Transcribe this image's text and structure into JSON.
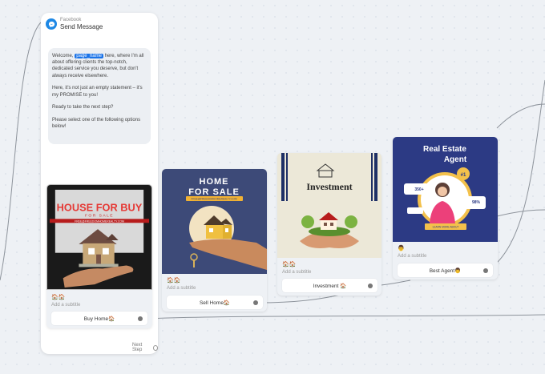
{
  "node": {
    "platform": "Facebook",
    "title": "Send Message",
    "message": {
      "p1_before": "Welcome, ",
      "p1_tag": "page_name",
      "p1_after": " here, where I'm all about offering clients the top-notch, dedicated service you deserve, but don't always receive elsewhere.",
      "p2": "Here, it's not just an empty statement – it's my PROMISE to you!",
      "p3": "Ready to take the next step?",
      "p4": "Please select one of the following options below!"
    },
    "next_step": "Next Step"
  },
  "cards": [
    {
      "image_heading": "HOUSE FOR BUY",
      "image_sub": "FOR SALE",
      "image_url": "FREE@FREEDOMHOMEREALTY.COM",
      "icons": "🏠🏠",
      "subtitle": "Add a subtitle",
      "button": "Buy Home🏠"
    },
    {
      "image_heading1": "HOME",
      "image_heading2": "FOR SALE",
      "image_url": "FREE@FREEDOMHOMEREALTY.COM",
      "icons": "🏠🏠",
      "subtitle": "Add a subtitle",
      "button": "Sell Home🏠"
    },
    {
      "image_heading": "Investment",
      "icons": "🏠🏠",
      "subtitle": "Add a subtitle",
      "button": "Investment 🏠"
    },
    {
      "image_heading1": "Real Estate",
      "image_heading2": "Agent",
      "badge": "#1",
      "stat1": "350+",
      "stat2": "98%",
      "image_footer": "LEARN MORE ABOUT",
      "icons": "👨",
      "subtitle": "Add a subtitle",
      "button": "Best Agent👨"
    }
  ],
  "colors": {
    "messenger": "#1e88e5",
    "card1_bg": "#1a1a1a",
    "card1_heading": "#e53935",
    "card2_bg": "#3d4a78",
    "card2_accent": "#f2b233",
    "card3_bg": "#ece8d8",
    "card4_bg": "#2c3a84",
    "card4_accent": "#f3c14b"
  }
}
